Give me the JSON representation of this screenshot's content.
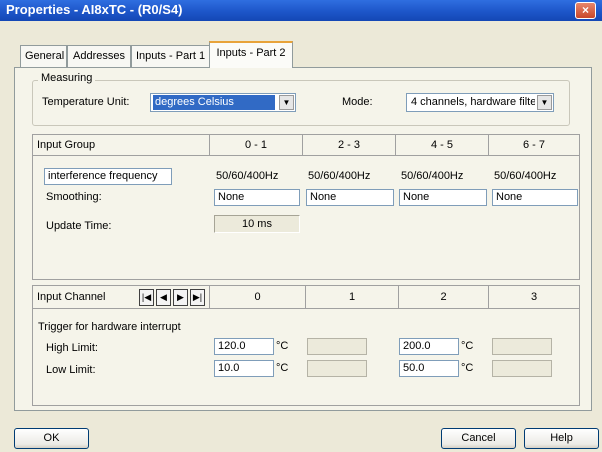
{
  "window": {
    "title": "Properties - AI8xTC - (R0/S4)",
    "close_glyph": "×"
  },
  "tabs": [
    {
      "label": "General",
      "active": false
    },
    {
      "label": "Addresses",
      "active": false
    },
    {
      "label": "Inputs - Part 1",
      "active": false
    },
    {
      "label": "Inputs - Part 2",
      "active": true
    }
  ],
  "measuring": {
    "group_label": "Measuring",
    "temp_unit_label": "Temperature Unit:",
    "temp_unit_value": "degrees Celsius",
    "mode_label": "Mode:",
    "mode_value": "4 channels, hardware filte"
  },
  "input_group": {
    "header_label": "Input Group",
    "columns": [
      "0 - 1",
      "2 - 3",
      "4 - 5",
      "6 - 7"
    ],
    "interference_label": "interference frequency",
    "interference_values": [
      "50/60/400Hz",
      "50/60/400Hz",
      "50/60/400Hz",
      "50/60/400Hz"
    ],
    "smoothing_label": "Smoothing:",
    "smoothing_values": [
      "None",
      "None",
      "None",
      "None"
    ],
    "update_time_label": "Update Time:",
    "update_time_value": "10 ms"
  },
  "input_channel": {
    "header_label": "Input Channel",
    "nav": [
      "|◀",
      "◀",
      "▶",
      "▶|"
    ],
    "columns": [
      "0",
      "1",
      "2",
      "3"
    ],
    "trigger_label": "Trigger for hardware interrupt",
    "high_limit_label": "High Limit:",
    "low_limit_label": "Low Limit:",
    "high_values": [
      "120.0",
      "",
      "200.0",
      ""
    ],
    "low_values": [
      "10.0",
      "",
      "50.0",
      ""
    ],
    "unit": "°C"
  },
  "buttons": {
    "ok": "OK",
    "cancel": "Cancel",
    "help": "Help"
  },
  "colors": {
    "titlebar": "#1d56c9",
    "selection": "#316ac5",
    "active_tab_accent": "#e8a33a"
  }
}
